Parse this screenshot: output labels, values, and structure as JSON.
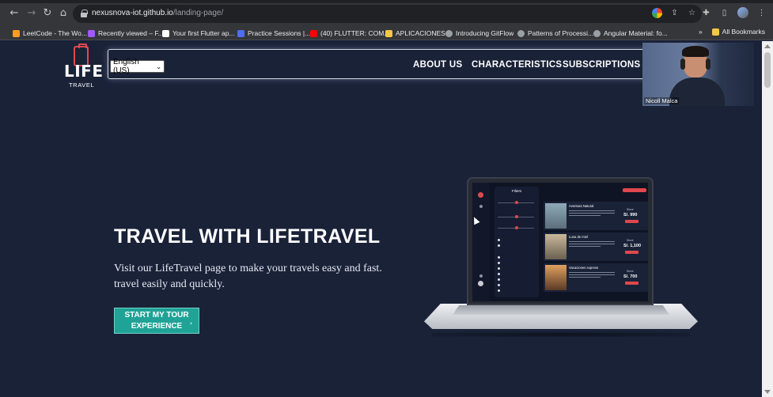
{
  "browser": {
    "url_host": "nexusnova-iot.github.io",
    "url_path": "/landing-page/",
    "bookmarks": [
      {
        "label": "LeetCode - The Wo...",
        "color": "#f89f1b"
      },
      {
        "label": "Recently viewed – F...",
        "color": "#a259ff"
      },
      {
        "label": "Your first Flutter ap...",
        "color": "#ffffff"
      },
      {
        "label": "Practice Sessions |...",
        "color": "#4e6ef2"
      },
      {
        "label": "(40) FLUTTER: COM...",
        "color": "#ff0000"
      },
      {
        "label": "APLICACIONES",
        "color": "#f6c744"
      },
      {
        "label": "Introducing GitFlow",
        "color": "#9aa0a6"
      },
      {
        "label": "Patterns of Processi...",
        "color": "#9aa0a6"
      },
      {
        "label": "Angular Material: fo...",
        "color": "#9aa0a6"
      }
    ],
    "more_label": "»",
    "all_bookmarks": "All Bookmarks"
  },
  "header": {
    "logo_main": "LIFE",
    "logo_sub": "TRAVEL",
    "language": "English (US)",
    "nav": [
      "ABOUT US",
      "CHARACTERISTICS",
      "SUBSCRIPTIONS"
    ]
  },
  "video": {
    "participant": "Nicoll Malca"
  },
  "hero": {
    "title": "TRAVEL WITH LIFETRAVEL",
    "text": "Visit our LifeTravel page to make your travels easy and fast. travel easily and quickly.",
    "cta": "START MY TOUR EXPERIENCE"
  },
  "mockup": {
    "filters_title": "Filters",
    "cards": [
      {
        "title": "Aventura Natural",
        "price": "S/. 990",
        "from": "Since",
        "img": "#5b6f7a"
      },
      {
        "title": "Luna de miel",
        "price": "S/. 1,100",
        "from": "Since",
        "img": "#8a7a60"
      },
      {
        "title": "Vacaciones express",
        "price": "S/. 700",
        "from": "Since",
        "img": "#a0603a"
      }
    ]
  },
  "colors": {
    "page_bg": "#1a2238",
    "accent_red": "#e0484d",
    "cta_teal": "#1fa396"
  }
}
